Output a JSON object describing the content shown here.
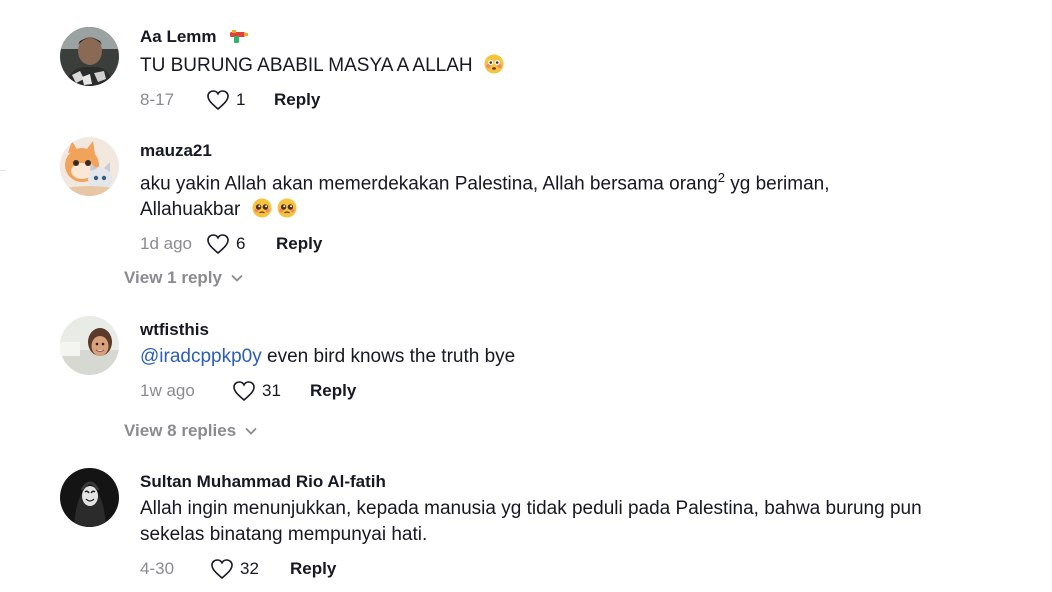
{
  "comments": [
    {
      "username": "Aa Lemm",
      "text": "TU BURUNG ABABIL MASYA A ALLAH",
      "date": "8-17",
      "likes": "1",
      "reply_label": "Reply",
      "badge_icon": "water-gun-icon",
      "emoji_icon": "flushed-face-emoji"
    },
    {
      "username": "mauza21",
      "text_line1": "aku yakin Allah akan memerdekakan Palestina, Allah bersama orang",
      "superscript": "2",
      "text_line1_end": " yg beriman,",
      "text_line2": "Allahuakbar",
      "date": "1d ago",
      "likes": "6",
      "reply_label": "Reply",
      "emoji_icon": "pleading-face-emoji",
      "view_replies": "View 1 reply"
    },
    {
      "username": "wtfisthis",
      "mention": "@iradcppkp0y",
      "text": " even bird knows the truth bye",
      "date": "1w ago",
      "likes": "31",
      "reply_label": "Reply",
      "view_replies": "View 8 replies"
    },
    {
      "username": "Sultan Muhammad Rio Al-fatih",
      "text": "Allah ingin menunjukkan, kepada manusia yg tidak peduli pada Palestina, bahwa burung pun sekelas binatang mempunyai hati.",
      "date": "4-30",
      "likes": "32",
      "reply_label": "Reply"
    }
  ],
  "colors": {
    "text": "#161823",
    "muted": "#8a8b91",
    "mention": "#2b5db9"
  }
}
